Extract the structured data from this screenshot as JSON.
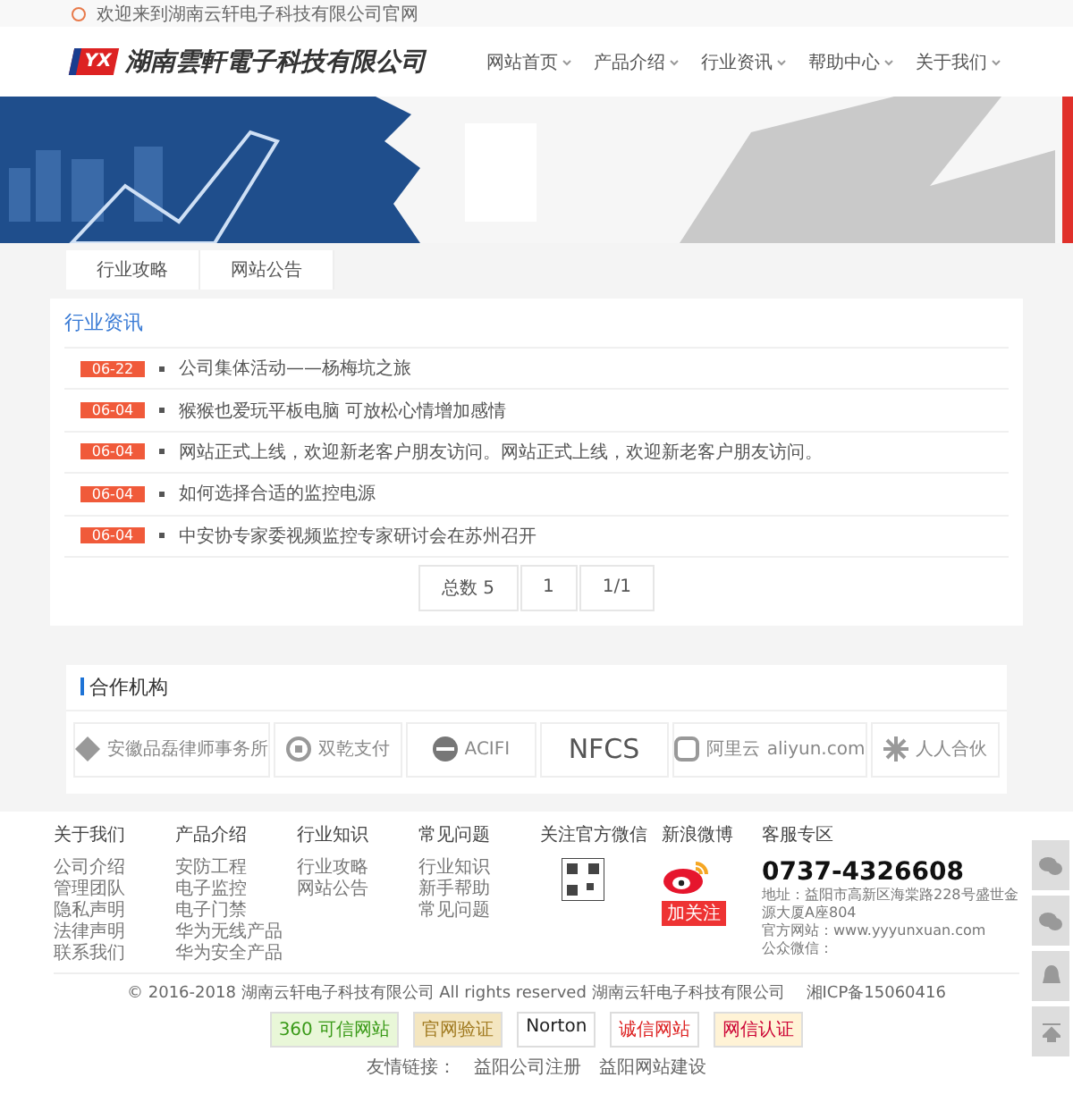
{
  "top_bar": {
    "welcome": "欢迎来到湖南云轩电子科技有限公司官网"
  },
  "header": {
    "logo_mark": "YX",
    "company_name": "湖南雲軒電子科技有限公司",
    "nav": [
      {
        "label": "网站首页"
      },
      {
        "label": "产品介绍"
      },
      {
        "label": "行业资讯"
      },
      {
        "label": "帮助中心"
      },
      {
        "label": "关于我们"
      }
    ]
  },
  "tabs": [
    {
      "label": "行业攻略",
      "selected": false
    },
    {
      "label": "网站公告",
      "selected": false
    }
  ],
  "news": {
    "title": "行业资讯",
    "items": [
      {
        "date": "06-22",
        "title": "公司集体活动——杨梅坑之旅"
      },
      {
        "date": "06-04",
        "title": "猴猴也爱玩平板电脑 可放松心情增加感情"
      },
      {
        "date": "06-04",
        "title": "网站正式上线，欢迎新老客户朋友访问。网站正式上线，欢迎新老客户朋友访问。"
      },
      {
        "date": "06-04",
        "title": "如何选择合适的监控电源"
      },
      {
        "date": "06-04",
        "title": "中安协专家委视频监控专家研讨会在苏州召开"
      }
    ],
    "pagination": [
      "总数 5",
      "1",
      "1/1"
    ]
  },
  "partners": {
    "title": "合作机构",
    "logos": [
      {
        "kind": "diamond",
        "name": "安徽品磊律师事务所"
      },
      {
        "kind": "coin",
        "name": "双乾支付"
      },
      {
        "kind": "circle",
        "name": "ACIFI"
      },
      {
        "kind": "plain",
        "name": "NFCS"
      },
      {
        "kind": "cloud",
        "name": "阿里云",
        "sub": "aliyun.com"
      },
      {
        "kind": "star",
        "name": "人人合伙"
      }
    ]
  },
  "footer": {
    "columns": [
      {
        "title": "关于我们",
        "links": [
          "公司介绍",
          "管理团队",
          "隐私声明",
          "法律声明",
          "联系我们"
        ]
      },
      {
        "title": "产品介绍",
        "links": [
          "安防工程",
          "电子监控",
          "电子门禁",
          "华为无线产品",
          "华为安全产品"
        ]
      },
      {
        "title": "行业知识",
        "links": [
          "行业攻略",
          "网站公告"
        ]
      },
      {
        "title": "常见问题",
        "links": [
          "行业知识",
          "新手帮助",
          "常见问题"
        ]
      }
    ],
    "wechat": {
      "title": "关注官方微信"
    },
    "weibo": {
      "title": "新浪微博",
      "follow": "加关注"
    },
    "service": {
      "title": "客服专区",
      "phone": "0737-4326608",
      "lines": [
        "地址：益阳市高新区海棠路228号盛世金源大厦A座804",
        "官方网站：www.yyyunxuan.com",
        "公众微信："
      ]
    },
    "copyright": "© 2016-2018 湖南云轩电子科技有限公司 All rights reserved 湖南云轩电子科技有限公司",
    "icp": "湘ICP备15060416",
    "badges": [
      {
        "kind": "green",
        "text": "360 可信网站"
      },
      {
        "kind": "gold",
        "text": "官网验证"
      },
      {
        "kind": "norton",
        "text": "Norton"
      },
      {
        "kind": "red",
        "text": "诚信网站"
      },
      {
        "kind": "cert",
        "text": "网信认证"
      }
    ],
    "links_label": "友情链接：",
    "links": [
      "益阳公司注册",
      "益阳网站建设"
    ]
  },
  "side_buttons": [
    {
      "kind": "wechat"
    },
    {
      "kind": "wechat"
    },
    {
      "kind": "qq"
    },
    {
      "kind": "top"
    }
  ]
}
